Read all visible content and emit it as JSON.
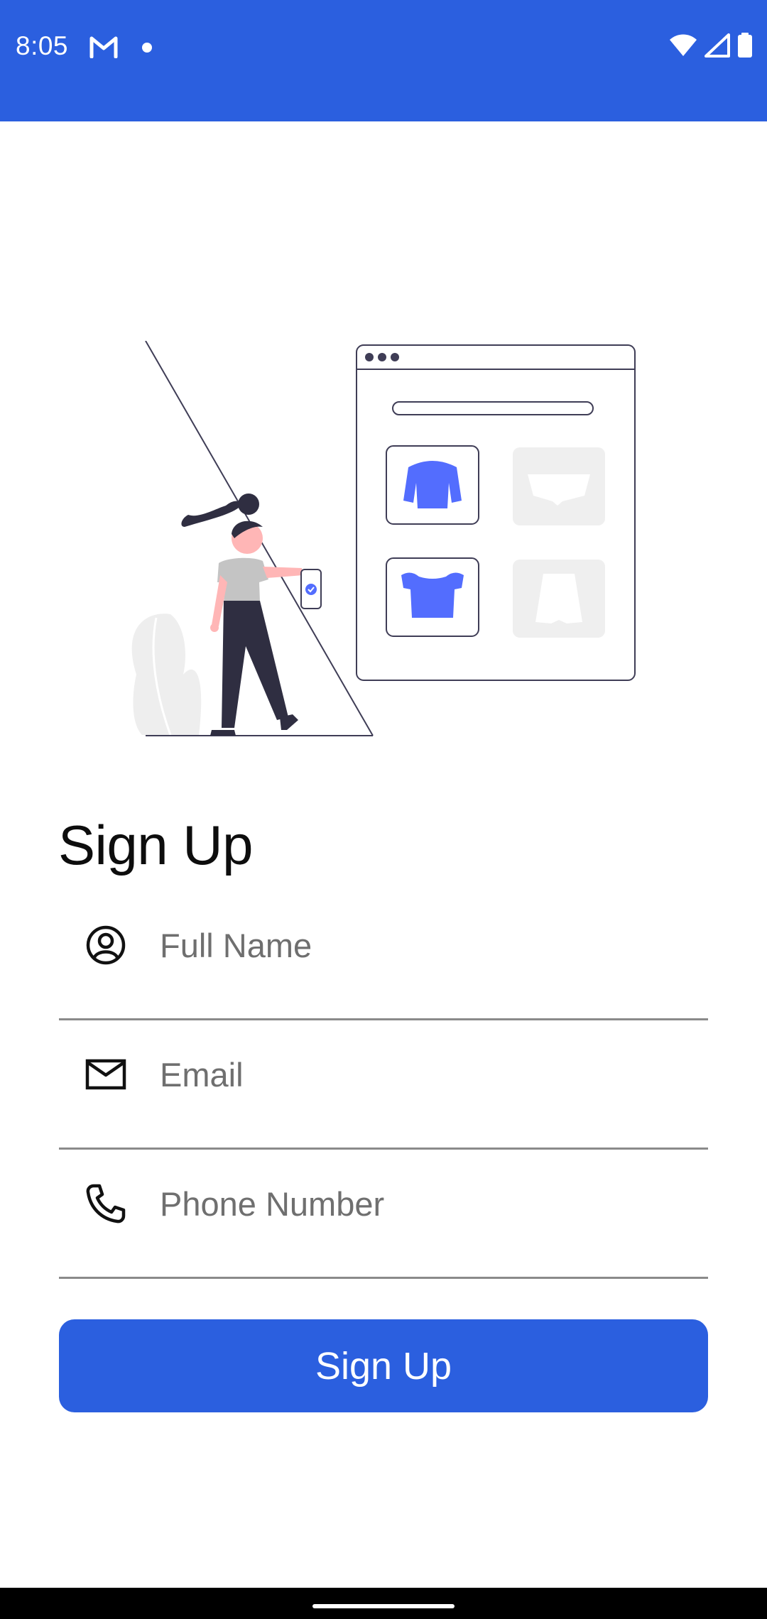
{
  "status_bar": {
    "time": "8:05",
    "notification_icons": [
      "gmail-icon",
      "dot-icon"
    ],
    "system_icons": [
      "wifi-icon",
      "signal-icon",
      "battery-icon"
    ],
    "background_color": "#2b5fdf"
  },
  "illustration": {
    "description_icon": "shopping-illustration",
    "accent_color": "#536dfe"
  },
  "page": {
    "title": "Sign Up"
  },
  "form": {
    "full_name": {
      "placeholder": "Full Name",
      "value": "",
      "icon": "account-circle-icon"
    },
    "email": {
      "placeholder": "Email",
      "value": "",
      "icon": "mail-icon"
    },
    "phone": {
      "placeholder": "Phone Number",
      "value": "",
      "icon": "phone-icon"
    },
    "submit_label": "Sign Up",
    "button_color": "#2b5fdf"
  },
  "nav_bar": {
    "handle": "gesture-handle"
  }
}
